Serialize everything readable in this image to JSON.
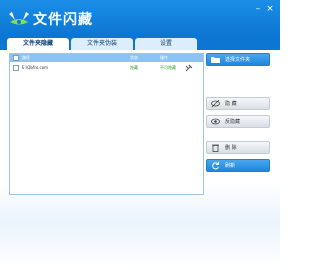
{
  "window": {
    "title": "文件闪藏"
  },
  "tabs": [
    {
      "label": "文件夹隐藏",
      "active": true
    },
    {
      "label": "文件夹伪装",
      "active": false
    },
    {
      "label": "设置",
      "active": false
    }
  ],
  "list": {
    "columns": [
      "路径",
      "状态",
      "操作"
    ],
    "rows": [
      {
        "path": "E:\\Qbfro.com",
        "status": "隐藏",
        "action": "不可隐藏"
      }
    ]
  },
  "buttons": {
    "select_folder": "选择文件夹",
    "hide": "隐 藏",
    "unhide": "反隐藏",
    "delete": "删 除",
    "refresh": "刷新"
  },
  "colors": {
    "accent": "#0c76d2",
    "tab_active": "#ffffff",
    "status_green": "#2e9a2e"
  }
}
